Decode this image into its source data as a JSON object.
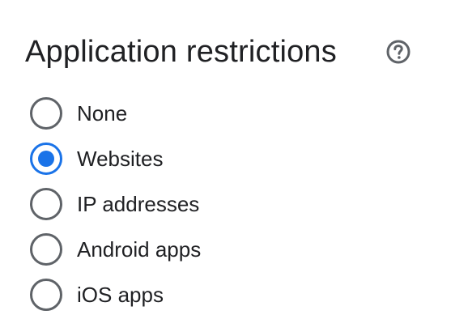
{
  "section": {
    "title": "Application restrictions",
    "help_icon": "help-circle-icon"
  },
  "options": [
    {
      "label": "None",
      "checked": false
    },
    {
      "label": "Websites",
      "checked": true
    },
    {
      "label": "IP addresses",
      "checked": false
    },
    {
      "label": "Android apps",
      "checked": false
    },
    {
      "label": "iOS apps",
      "checked": false
    }
  ],
  "colors": {
    "accent": "#1a73e8",
    "radio_border": "#5f6368",
    "text": "#202124"
  }
}
